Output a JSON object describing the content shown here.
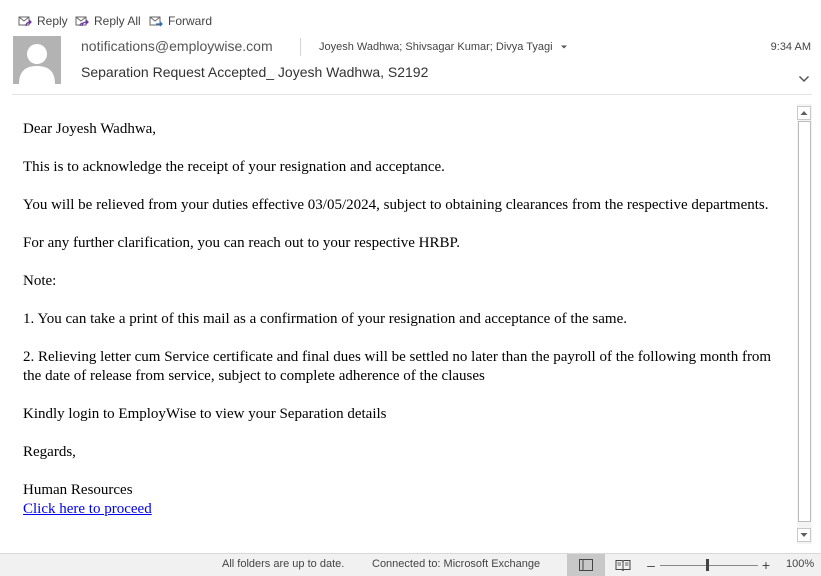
{
  "toolbar": {
    "reply_label": "Reply",
    "reply_all_label": "Reply All",
    "forward_label": "Forward"
  },
  "header": {
    "sender": "notifications@employwise.com",
    "recipients": "Joyesh Wadhwa; Shivsagar Kumar; Divya Tyagi",
    "time": "9:34 AM",
    "subject": "Separation Request Accepted_ Joyesh Wadhwa, S2192"
  },
  "body": {
    "greeting": "Dear Joyesh Wadhwa,",
    "p1": "This is to acknowledge the receipt of your resignation and acceptance.",
    "p2": "You will be relieved from your duties effective 03/05/2024, subject to obtaining clearances from the respective departments.",
    "p3": "For any further clarification, you can reach out to your respective HRBP.",
    "note": "Note:",
    "item1": "1. You can take a print of this mail as a confirmation of your resignation and acceptance of the same.",
    "item2": "2. Relieving letter cum Service certificate and final dues will be settled no later than the payroll of the following month from the date of release from service, subject to complete adherence of the clauses",
    "login": "Kindly login to EmployWise to view your Separation details",
    "regards": "Regards,",
    "signature": "Human Resources",
    "link": "Click here to proceed"
  },
  "statusbar": {
    "sync": "All folders are up to date.",
    "connection": "Connected to: Microsoft Exchange",
    "zoom": "100%",
    "zoom_minus": "–",
    "zoom_plus": "+"
  },
  "icons": {
    "reply": "reply-icon",
    "reply_all": "reply-all-icon",
    "forward": "forward-icon",
    "avatar": "person-silhouette-icon",
    "recipients_dropdown": "caret-down-icon",
    "expand_header": "chevron-down-icon",
    "scroll_up": "triangle-up-icon",
    "scroll_down": "triangle-down-icon",
    "normal_view": "normal-view-icon",
    "reading_view": "reading-view-icon"
  },
  "colors": {
    "link": "#0000ee",
    "icon_accent": "#6c3aa0",
    "statusbar_bg": "#f1f1f1",
    "active_view_bg": "#c8c8c8"
  }
}
